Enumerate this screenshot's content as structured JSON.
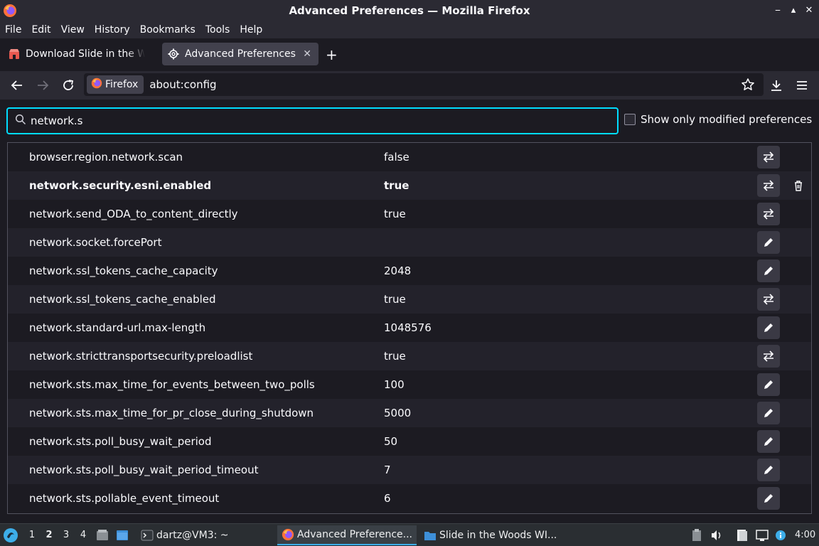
{
  "window": {
    "title": "Advanced Preferences — Mozilla Firefox",
    "controls": {
      "minimize": "⎯",
      "maximize": "▴",
      "close": "✕"
    }
  },
  "menubar": {
    "items": [
      {
        "label": "File"
      },
      {
        "label": "Edit"
      },
      {
        "label": "View"
      },
      {
        "label": "History"
      },
      {
        "label": "Bookmarks"
      },
      {
        "label": "Tools"
      },
      {
        "label": "Help"
      }
    ]
  },
  "tabs": [
    {
      "label": "Download Slide in the Woods",
      "icon": "store-icon",
      "active": false
    },
    {
      "label": "Advanced Preferences",
      "icon": "gear-icon",
      "active": true,
      "close": "✕"
    }
  ],
  "new_tab": "+",
  "navbar": {
    "identity_label": "Firefox",
    "url": "about:config"
  },
  "config": {
    "search_value": "network.s",
    "show_modified_label": "Show only modified preferences",
    "show_modified_checked": false,
    "rows": [
      {
        "name": "browser.region.network.scan",
        "value": "false",
        "action": "toggle",
        "modified": false
      },
      {
        "name": "network.security.esni.enabled",
        "value": "true",
        "action": "toggle",
        "modified": true
      },
      {
        "name": "network.send_ODA_to_content_directly",
        "value": "true",
        "action": "toggle",
        "modified": false
      },
      {
        "name": "network.socket.forcePort",
        "value": "",
        "action": "edit",
        "modified": false
      },
      {
        "name": "network.ssl_tokens_cache_capacity",
        "value": "2048",
        "action": "edit",
        "modified": false
      },
      {
        "name": "network.ssl_tokens_cache_enabled",
        "value": "true",
        "action": "toggle",
        "modified": false
      },
      {
        "name": "network.standard-url.max-length",
        "value": "1048576",
        "action": "edit",
        "modified": false
      },
      {
        "name": "network.stricttransportsecurity.preloadlist",
        "value": "true",
        "action": "toggle",
        "modified": false
      },
      {
        "name": "network.sts.max_time_for_events_between_two_polls",
        "value": "100",
        "action": "edit",
        "modified": false
      },
      {
        "name": "network.sts.max_time_for_pr_close_during_shutdown",
        "value": "5000",
        "action": "edit",
        "modified": false
      },
      {
        "name": "network.sts.poll_busy_wait_period",
        "value": "50",
        "action": "edit",
        "modified": false
      },
      {
        "name": "network.sts.poll_busy_wait_period_timeout",
        "value": "7",
        "action": "edit",
        "modified": false
      },
      {
        "name": "network.sts.pollable_event_timeout",
        "value": "6",
        "action": "edit",
        "modified": false
      }
    ]
  },
  "taskbar": {
    "workspaces": [
      "1",
      "2",
      "3",
      "4"
    ],
    "active_workspace": "2",
    "terminal_label": "dartz@VM3: ~",
    "apps": [
      {
        "label": "Advanced Preference...",
        "icon": "firefox-icon",
        "active": true
      },
      {
        "label": "Slide in the Woods WI...",
        "icon": "folder-icon",
        "active": false
      }
    ],
    "clock": "4:00"
  },
  "colors": {
    "accent": "#00ddff",
    "background": "#1c1b22",
    "toolbar": "#2b2a33",
    "taskbar": "#2a2e32",
    "taskbar_accent": "#3daee9"
  }
}
